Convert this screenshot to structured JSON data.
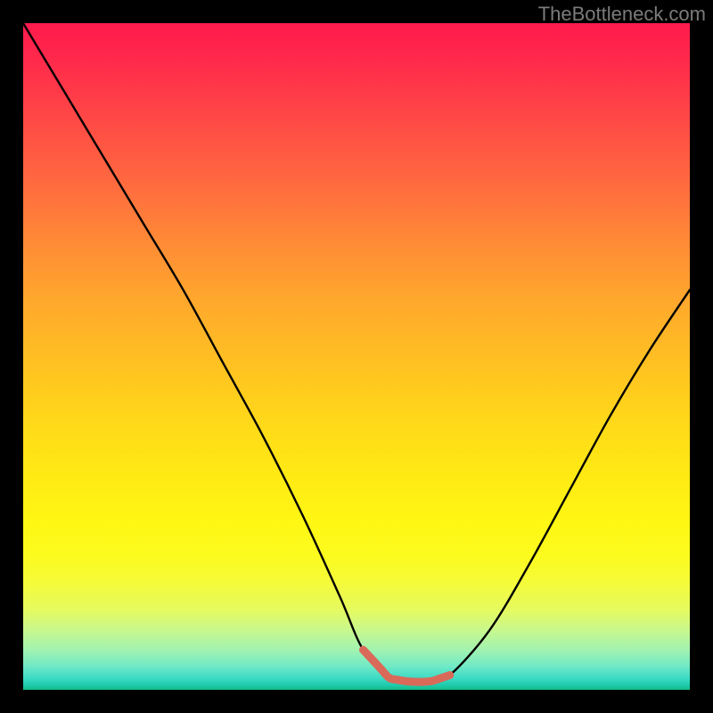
{
  "watermark": {
    "text": "TheBottleneck.com"
  },
  "colors": {
    "curve": "#000000",
    "accent": "#d96a5a",
    "frame": "#000000"
  },
  "chart_data": {
    "type": "line",
    "title": "",
    "xlabel": "",
    "ylabel": "",
    "xlim": [
      0,
      100
    ],
    "ylim": [
      0,
      100
    ],
    "grid": false,
    "legend": null,
    "series": [
      {
        "name": "bottleneck-curve",
        "x": [
          0,
          6,
          12,
          18,
          24,
          30,
          36,
          42,
          47.5,
          51,
          55,
          58,
          61,
          64,
          70,
          76,
          82,
          88,
          94,
          100
        ],
        "y": [
          100,
          90,
          80,
          70,
          60,
          49,
          38,
          26,
          14,
          6,
          1.7,
          1.2,
          1.2,
          2.2,
          9,
          19,
          30,
          41,
          51,
          60
        ]
      }
    ],
    "accent_segment": {
      "note": "highlighted low-bottleneck zone near curve minimum",
      "x_range": [
        51,
        64
      ],
      "y_approx": 1.5
    },
    "gradient_scale": {
      "axis": "y",
      "stops": [
        {
          "pct": 0,
          "color": "#ff1a4d"
        },
        {
          "pct": 50,
          "color": "#ffd000"
        },
        {
          "pct": 85,
          "color": "#f6fb2a"
        },
        {
          "pct": 100,
          "color": "#14bb86"
        }
      ]
    }
  }
}
